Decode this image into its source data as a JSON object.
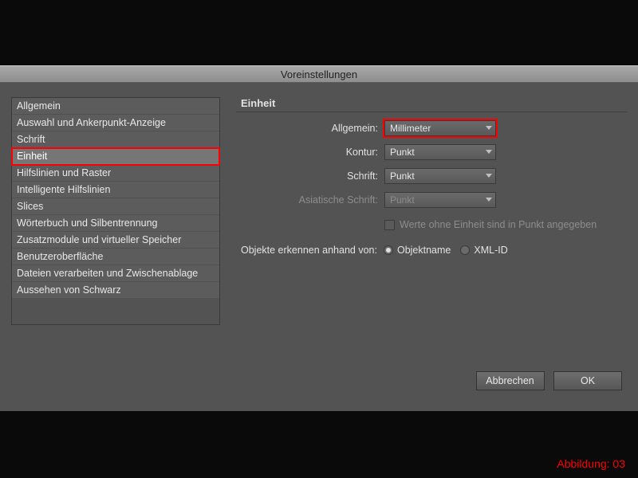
{
  "titlebar": "Voreinstellungen",
  "sidebar": {
    "items": [
      "Allgemein",
      "Auswahl und Ankerpunkt-Anzeige",
      "Schrift",
      "Einheit",
      "Hilfslinien und Raster",
      "Intelligente Hilfslinien",
      "Slices",
      "Wörterbuch und Silbentrennung",
      "Zusatzmodule und virtueller Speicher",
      "Benutzeroberfläche",
      "Dateien verarbeiten und Zwischenablage",
      "Aussehen von Schwarz"
    ],
    "selected_index": 3
  },
  "section_title": "Einheit",
  "fields": {
    "allgemein": {
      "label": "Allgemein:",
      "value": "Millimeter"
    },
    "kontur": {
      "label": "Kontur:",
      "value": "Punkt"
    },
    "schrift": {
      "label": "Schrift:",
      "value": "Punkt"
    },
    "asian": {
      "label": "Asiatische Schrift:",
      "value": "Punkt"
    }
  },
  "checkbox_label": "Werte ohne Einheit sind in Punkt angegeben",
  "radio": {
    "label": "Objekte erkennen anhand von:",
    "opt1": "Objektname",
    "opt2": "XML-ID"
  },
  "buttons": {
    "cancel": "Abbrechen",
    "ok": "OK"
  },
  "caption": "Abbildung: 03"
}
